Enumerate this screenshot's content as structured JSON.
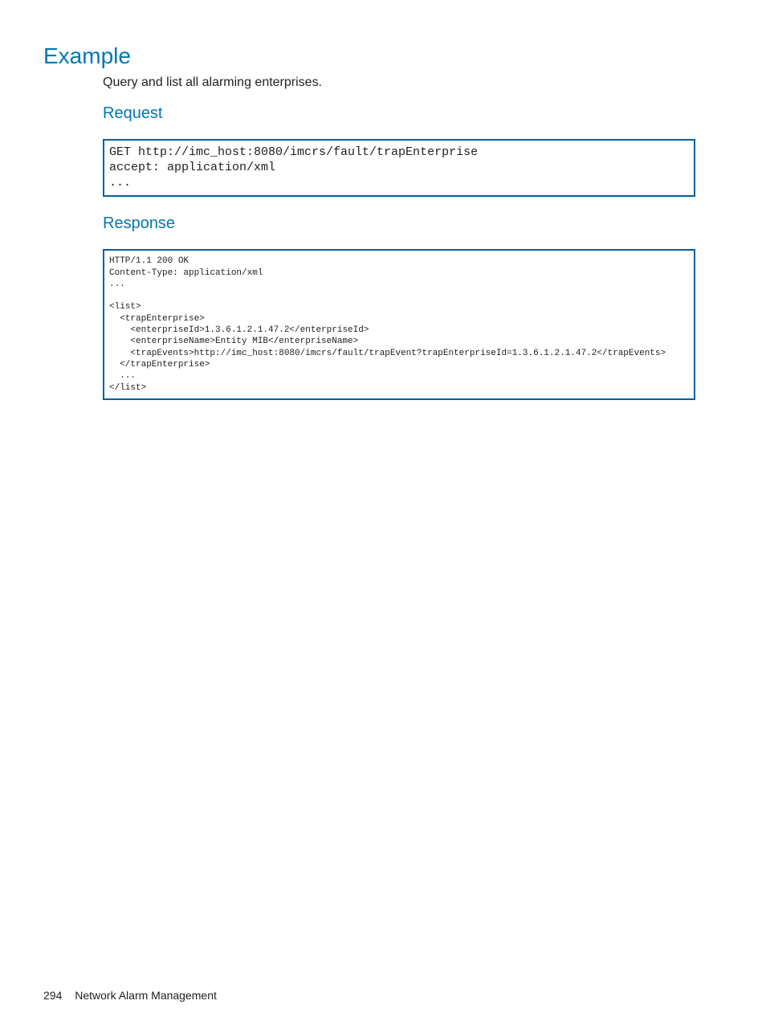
{
  "headings": {
    "example": "Example",
    "request": "Request",
    "response": "Response"
  },
  "intro": "Query and list all alarming enterprises.",
  "request_code": "GET http://imc_host:8080/imcrs/fault/trapEnterprise\naccept: application/xml\n...",
  "response_code": "HTTP/1.1 200 OK\nContent-Type: application/xml\n...\n\n<list>\n  <trapEnterprise>\n    <enterpriseId>1.3.6.1.2.1.47.2</enterpriseId>\n    <enterpriseName>Entity MIB</enterpriseName>\n    <trapEvents>http://imc_host:8080/imcrs/fault/trapEvent?trapEnterpriseId=1.3.6.1.2.1.47.2</trapEvents>\n  </trapEnterprise>\n  ...\n</list>",
  "footer": {
    "page_number": "294",
    "section": "Network Alarm Management"
  }
}
